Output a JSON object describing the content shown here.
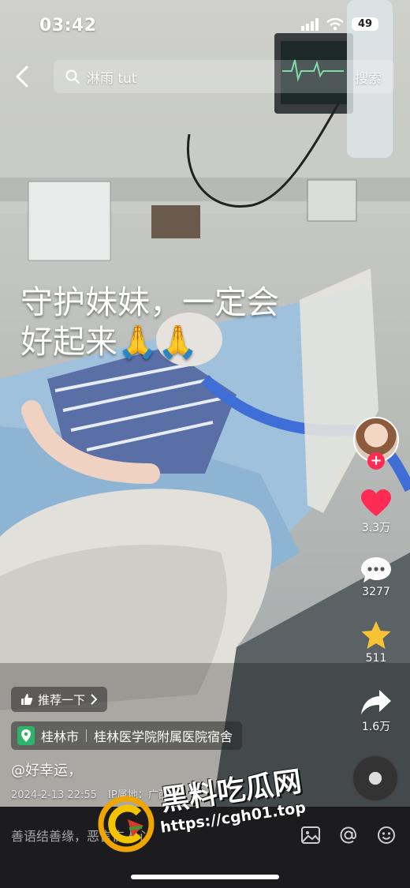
{
  "status_bar": {
    "time": "03:42",
    "battery": "49"
  },
  "search": {
    "query": "淋雨 tut",
    "button": "搜索"
  },
  "overlay_text": {
    "line1": "守护妹妹，一定会",
    "line2": "好起来🙏🙏"
  },
  "actions": {
    "likes": "3.3万",
    "comments": "3277",
    "favorites": "511",
    "shares": "1.6万"
  },
  "recommend": {
    "label": "推荐一下"
  },
  "location": {
    "city": "桂林市",
    "place": "桂林医学院附属医院宿舍"
  },
  "post": {
    "username": "@好幸运，",
    "date": "2024-2-13 22:55",
    "ip": "IP属地：广西"
  },
  "comment_bar": {
    "placeholder": "善语结善缘，恶言伤人心"
  },
  "watermark": {
    "title": "黑料吃瓜网",
    "url": "https://cgh01.top"
  },
  "colors": {
    "accent": "#fe2c55",
    "star": "#f7c335",
    "comment_bar_bg": "#1c1c1e"
  }
}
